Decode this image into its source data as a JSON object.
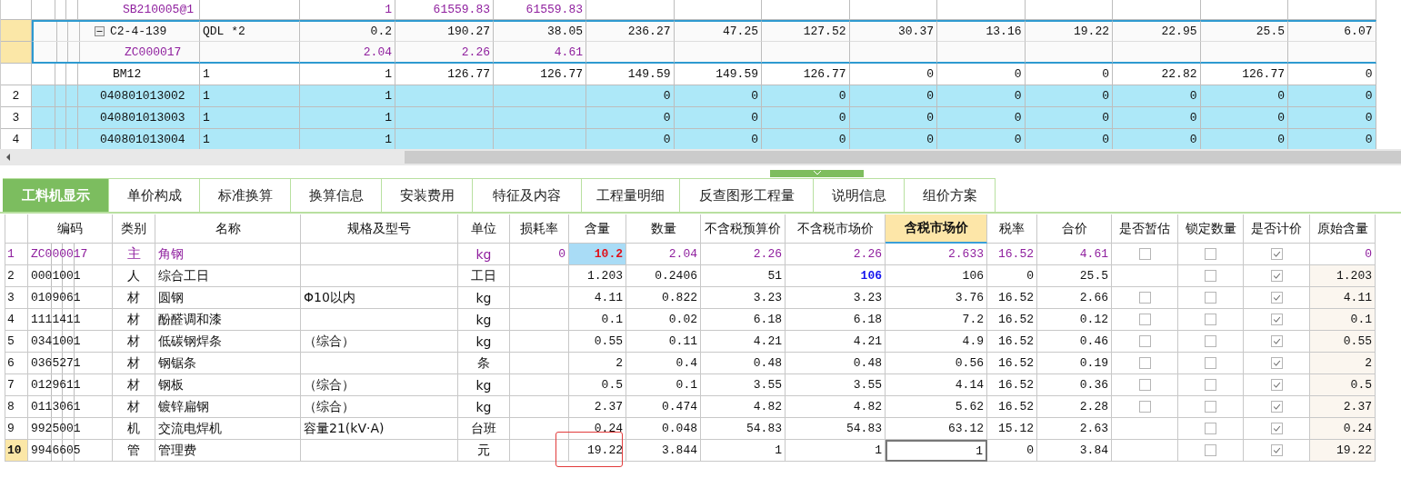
{
  "top_grid": {
    "rows": [
      {
        "kind": "sub",
        "selected": false,
        "code": "SB210005@1",
        "column_3": "1",
        "column_4": "61559.83",
        "column_5": "61559.83"
      },
      {
        "kind": "quota",
        "selected": true,
        "expanded": true,
        "code": "C2-4-139",
        "column_2": "QDL *2",
        "column_3": "0.2",
        "column_4": "190.27",
        "column_5": "38.05",
        "column_6": "236.27",
        "column_7": "47.25",
        "column_8": "127.52",
        "column_9": "30.37",
        "column_10": "13.16",
        "column_11": "19.22",
        "column_12": "22.95",
        "column_13": "25.5",
        "column_14": "6.07",
        "children": [
          {
            "kind": "sub",
            "selected": true,
            "code": "ZC000017",
            "column_3": "2.04",
            "column_4": "2.26",
            "column_5": "4.61"
          }
        ]
      },
      {
        "kind": "quota",
        "selected": false,
        "code": "BM12",
        "column_2": "1",
        "column_3": "1",
        "column_4": "126.77",
        "column_5": "126.77",
        "column_6": "149.59",
        "column_7": "149.59",
        "column_8": "126.77",
        "column_9": "0",
        "column_10": "0",
        "column_11": "0",
        "column_12": "22.82",
        "column_13": "126.77",
        "column_14": "0"
      },
      {
        "kind": "bill",
        "selected": false,
        "number": "2",
        "code": "040801013002",
        "column_2": "1",
        "column_3": "1",
        "column_6": "0",
        "column_7": "0",
        "column_8": "0",
        "column_9": "0",
        "column_10": "0",
        "column_11": "0",
        "column_12": "0",
        "column_13": "0",
        "column_14": "0"
      },
      {
        "kind": "bill",
        "selected": false,
        "number": "3",
        "code": "040801013003",
        "column_2": "1",
        "column_3": "1",
        "column_6": "0",
        "column_7": "0",
        "column_8": "0",
        "column_9": "0",
        "column_10": "0",
        "column_11": "0",
        "column_12": "0",
        "column_13": "0",
        "column_14": "0"
      },
      {
        "kind": "bill",
        "selected": false,
        "number": "4",
        "code": "040801013004",
        "column_2": "1",
        "column_3": "1",
        "column_6": "0",
        "column_7": "0",
        "column_8": "0",
        "column_9": "0",
        "column_10": "0",
        "column_11": "0",
        "column_12": "0",
        "column_13": "0",
        "column_14": "0"
      }
    ]
  },
  "tabs": [
    {
      "label": "工料机显示",
      "selected": true
    },
    {
      "label": "单价构成",
      "selected": false
    },
    {
      "label": "标准换算",
      "selected": false
    },
    {
      "label": "换算信息",
      "selected": false
    },
    {
      "label": "安装费用",
      "selected": false
    },
    {
      "label": "特征及内容",
      "selected": false
    },
    {
      "label": "工程量明细",
      "selected": false
    },
    {
      "label": "反查图形工程量",
      "selected": false
    },
    {
      "label": "说明信息",
      "selected": false
    },
    {
      "label": "组价方案",
      "selected": false
    }
  ],
  "table": {
    "columns": [
      {
        "label": "编码",
        "selected": false
      },
      {
        "label": "类别",
        "selected": false
      },
      {
        "label": "名称",
        "selected": false
      },
      {
        "label": "规格及型号",
        "selected": false
      },
      {
        "label": "单位",
        "selected": false
      },
      {
        "label": "损耗率",
        "selected": false
      },
      {
        "label": "含量",
        "selected": false
      },
      {
        "label": "数量",
        "selected": false
      },
      {
        "label": "不含税预算价",
        "selected": false
      },
      {
        "label": "不含税市场价",
        "selected": false
      },
      {
        "label": "含税市场价",
        "selected": true
      },
      {
        "label": "税率",
        "selected": false
      },
      {
        "label": "合价",
        "selected": false
      },
      {
        "label": "是否暂估",
        "selected": false
      },
      {
        "label": "锁定数量",
        "selected": false
      },
      {
        "label": "是否计价",
        "selected": false
      },
      {
        "label": "原始含量",
        "selected": false
      }
    ],
    "rows": [
      {
        "number": "1",
        "kind": "main",
        "selected": false,
        "content_edited": true,
        "market_price_edited": false,
        "circled": false,
        "code": "ZC000017",
        "category": "主",
        "name": "角钢",
        "unit": "kg",
        "loss_rate": "0",
        "content": "10.2",
        "quantity": "2.04",
        "budget_price_excl_tax": "2.26",
        "market_price_excl_tax": "2.26",
        "market_price_incl_tax": "2.633",
        "tax_rate": "16.52",
        "total": "4.61",
        "provisional": false,
        "locked": false,
        "priced": true,
        "original_content": "0"
      },
      {
        "number": "2",
        "kind": "normal",
        "selected": false,
        "content_edited": false,
        "market_price_edited": true,
        "circled": false,
        "code": "0001001",
        "category": "人",
        "name": "综合工日",
        "unit": "工日",
        "content": "1.203",
        "quantity": "0.2406",
        "budget_price_excl_tax": "51",
        "market_price_excl_tax": "106",
        "market_price_incl_tax": "106",
        "tax_rate": "0",
        "total": "25.5",
        "locked": false,
        "priced": true,
        "original_content": "1.203"
      },
      {
        "number": "3",
        "kind": "normal",
        "selected": false,
        "content_edited": false,
        "market_price_edited": false,
        "circled": false,
        "code": "0109061",
        "category": "材",
        "name": "圆钢",
        "spec": "Φ10以内",
        "unit": "kg",
        "content": "4.11",
        "quantity": "0.822",
        "budget_price_excl_tax": "3.23",
        "market_price_excl_tax": "3.23",
        "market_price_incl_tax": "3.76",
        "tax_rate": "16.52",
        "total": "2.66",
        "provisional": false,
        "locked": false,
        "priced": true,
        "original_content": "4.11"
      },
      {
        "number": "4",
        "kind": "normal",
        "selected": false,
        "content_edited": false,
        "market_price_edited": false,
        "circled": false,
        "code": "1111411",
        "category": "材",
        "name": "酚醛调和漆",
        "unit": "kg",
        "content": "0.1",
        "quantity": "0.02",
        "budget_price_excl_tax": "6.18",
        "market_price_excl_tax": "6.18",
        "market_price_incl_tax": "7.2",
        "tax_rate": "16.52",
        "total": "0.12",
        "provisional": false,
        "locked": false,
        "priced": true,
        "original_content": "0.1"
      },
      {
        "number": "5",
        "kind": "normal",
        "selected": false,
        "content_edited": false,
        "market_price_edited": false,
        "circled": false,
        "code": "0341001",
        "category": "材",
        "name": "低碳钢焊条",
        "spec": "（综合）",
        "unit": "kg",
        "content": "0.55",
        "quantity": "0.11",
        "budget_price_excl_tax": "4.21",
        "market_price_excl_tax": "4.21",
        "market_price_incl_tax": "4.9",
        "tax_rate": "16.52",
        "total": "0.46",
        "provisional": false,
        "locked": false,
        "priced": true,
        "original_content": "0.55"
      },
      {
        "number": "6",
        "kind": "normal",
        "selected": false,
        "content_edited": false,
        "market_price_edited": false,
        "circled": false,
        "code": "0365271",
        "category": "材",
        "name": "钢锯条",
        "unit": "条",
        "content": "2",
        "quantity": "0.4",
        "budget_price_excl_tax": "0.48",
        "market_price_excl_tax": "0.48",
        "market_price_incl_tax": "0.56",
        "tax_rate": "16.52",
        "total": "0.19",
        "provisional": false,
        "locked": false,
        "priced": true,
        "original_content": "2"
      },
      {
        "number": "7",
        "kind": "normal",
        "selected": false,
        "content_edited": false,
        "market_price_edited": false,
        "circled": false,
        "code": "0129611",
        "category": "材",
        "name": "钢板",
        "spec": "（综合）",
        "unit": "kg",
        "content": "0.5",
        "quantity": "0.1",
        "budget_price_excl_tax": "3.55",
        "market_price_excl_tax": "3.55",
        "market_price_incl_tax": "4.14",
        "tax_rate": "16.52",
        "total": "0.36",
        "provisional": false,
        "locked": false,
        "priced": true,
        "original_content": "0.5"
      },
      {
        "number": "8",
        "kind": "normal",
        "selected": false,
        "content_edited": false,
        "market_price_edited": false,
        "circled": false,
        "code": "0113061",
        "category": "材",
        "name": "镀锌扁钢",
        "spec": "（综合）",
        "unit": "kg",
        "content": "2.37",
        "quantity": "0.474",
        "budget_price_excl_tax": "4.82",
        "market_price_excl_tax": "4.82",
        "market_price_incl_tax": "5.62",
        "tax_rate": "16.52",
        "total": "2.28",
        "provisional": false,
        "locked": false,
        "priced": true,
        "original_content": "2.37"
      },
      {
        "number": "9",
        "kind": "normal",
        "selected": false,
        "content_edited": false,
        "market_price_edited": false,
        "circled": false,
        "code": "9925001",
        "category": "机",
        "name": "交流电焊机",
        "spec": "容量21(kV·A)",
        "unit": "台班",
        "content": "0.24",
        "quantity": "0.048",
        "budget_price_excl_tax": "54.83",
        "market_price_excl_tax": "54.83",
        "market_price_incl_tax": "63.12",
        "tax_rate": "15.12",
        "total": "2.63",
        "locked": false,
        "priced": true,
        "original_content": "0.24"
      },
      {
        "number": "10",
        "kind": "normal",
        "selected": true,
        "content_edited": false,
        "market_price_edited": false,
        "circled": true,
        "code": "9946605",
        "category": "管",
        "name": "管理费",
        "unit": "元",
        "content": "19.22",
        "quantity": "3.844",
        "budget_price_excl_tax": "1",
        "market_price_excl_tax": "1",
        "market_price_incl_tax": "1",
        "tax_rate": "0",
        "total": "3.84",
        "locked": false,
        "priced": true,
        "original_content": "19.22"
      }
    ]
  }
}
